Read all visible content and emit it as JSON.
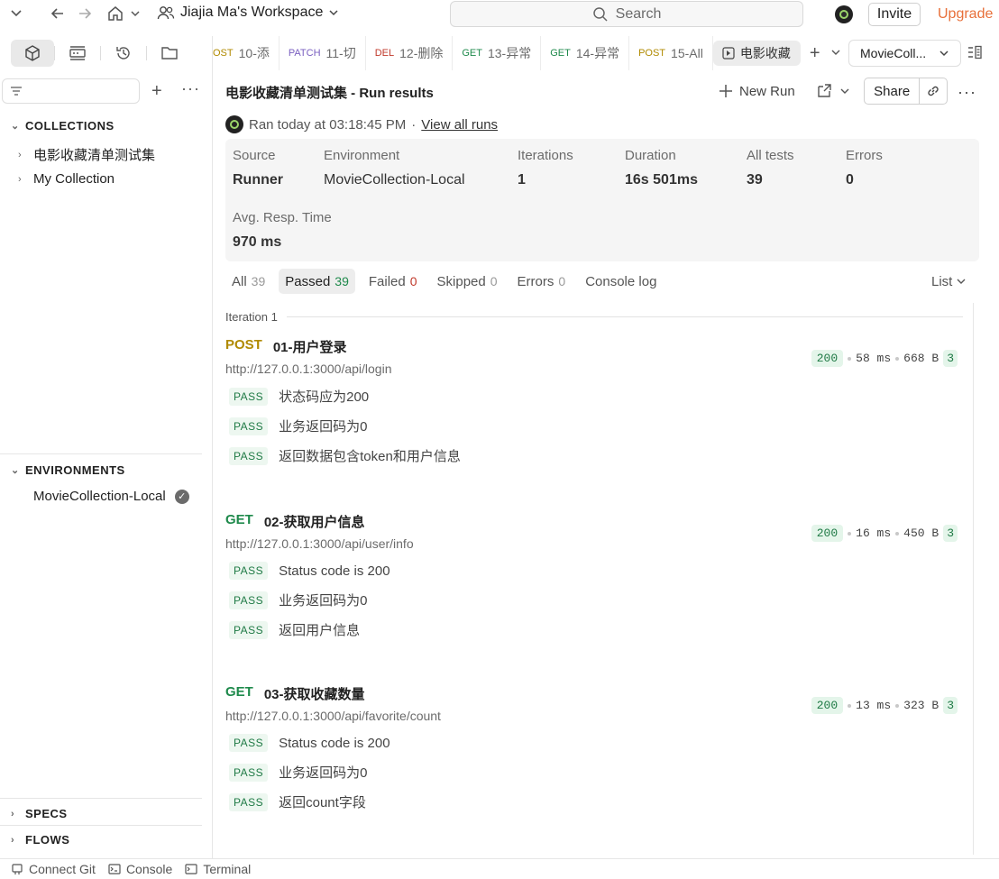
{
  "topbar": {
    "workspace": "Jiajia Ma's Workspace",
    "search_placeholder": "Search",
    "invite": "Invite",
    "upgrade": "Upgrade"
  },
  "sidebar": {
    "collections_label": "COLLECTIONS",
    "collections": [
      "电影收藏清单测试集",
      "My Collection"
    ],
    "environments_label": "ENVIRONMENTS",
    "environment": "MovieCollection-Local",
    "specs_label": "SPECS",
    "flows_label": "FLOWS"
  },
  "tabs": [
    {
      "method": "OST",
      "method_class": "m-post",
      "name": "10-添"
    },
    {
      "method": "PATCH",
      "method_class": "m-patch",
      "name": "11-切"
    },
    {
      "method": "DEL",
      "method_class": "m-del",
      "name": "12-删除"
    },
    {
      "method": "GET",
      "method_class": "m-get",
      "name": "13-异常"
    },
    {
      "method": "GET",
      "method_class": "m-get",
      "name": "14-异常"
    },
    {
      "method": "POST",
      "method_class": "m-post",
      "name": "15-All"
    },
    {
      "method": "",
      "method_class": "",
      "name": "电影收藏"
    }
  ],
  "env_select": "MovieColl...",
  "run": {
    "title": "电影收藏清单测试集 - Run results",
    "new_run": "New Run",
    "share": "Share",
    "ran_text": "Ran today at 03:18:45 PM",
    "view_all": "View all runs"
  },
  "summary": {
    "source_label": "Source",
    "source": "Runner",
    "env_label": "Environment",
    "env": "MovieCollection-Local",
    "iter_label": "Iterations",
    "iter": "1",
    "dur_label": "Duration",
    "dur": "16s 501ms",
    "tests_label": "All tests",
    "tests": "39",
    "errors_label": "Errors",
    "errors": "0",
    "avg_label": "Avg. Resp. Time",
    "avg": "970 ms"
  },
  "filters": {
    "all": "All",
    "all_count": "39",
    "passed": "Passed",
    "passed_count": "39",
    "failed": "Failed",
    "failed_count": "0",
    "skipped": "Skipped",
    "skipped_count": "0",
    "errors": "Errors",
    "errors_count": "0",
    "console": "Console log",
    "list": "List"
  },
  "iteration_label": "Iteration 1",
  "requests": [
    {
      "method": "POST",
      "name": "01-用户登录",
      "url": "http://127.0.0.1:3000/api/login",
      "status": "200",
      "time": "58 ms",
      "size": "668 B",
      "count": "3",
      "tests": [
        "状态码应为200",
        "业务返回码为0",
        "返回数据包含token和用户信息"
      ]
    },
    {
      "method": "GET",
      "name": "02-获取用户信息",
      "url": "http://127.0.0.1:3000/api/user/info",
      "status": "200",
      "time": "16 ms",
      "size": "450 B",
      "count": "3",
      "tests": [
        "Status code is 200",
        "业务返回码为0",
        "返回用户信息"
      ]
    },
    {
      "method": "GET",
      "name": "03-获取收藏数量",
      "url": "http://127.0.0.1:3000/api/favorite/count",
      "status": "200",
      "time": "13 ms",
      "size": "323 B",
      "count": "3",
      "tests": [
        "Status code is 200",
        "业务返回码为0",
        "返回count字段"
      ]
    }
  ],
  "pass_label": "PASS",
  "bottombar": {
    "git": "Connect Git",
    "console": "Console",
    "terminal": "Terminal"
  }
}
